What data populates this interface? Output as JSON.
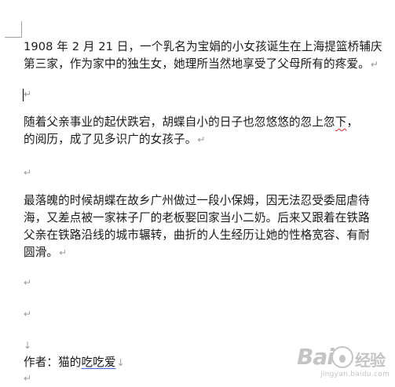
{
  "document": {
    "lines": [
      {
        "text": "1908 年 2 月 21 日，一个乳名为宝娟的小女孩诞生在上海提篮桥辅庆"
      },
      {
        "text": "第三家，作为家中的独生女，她理所当然地享受了父母所有的疼爱。"
      },
      {
        "text": ""
      },
      {
        "text": ""
      },
      {
        "text_before": "随着父亲事业的起伏跌宕，胡蝶自小的日子也忽悠悠的忽上忽",
        "squiggle": "下",
        "text_after": "，"
      },
      {
        "text": "的阅历，成了见多识广的女孩子。"
      },
      {
        "text": ""
      },
      {
        "text": ""
      },
      {
        "text": "最落魄的时候胡蝶在故乡广州做过一段小保姆，因无法忍受委屈虐待"
      },
      {
        "text": "海，又差点被一家袜子厂的老板娶回家当小二奶。后来又跟着在铁路"
      },
      {
        "text": "父亲在铁路沿线的城市辗转，曲折的人生经历让她的性格宽容、有耐"
      },
      {
        "text": "圆滑。"
      },
      {
        "text": ""
      },
      {
        "text": ""
      },
      {
        "text": ""
      },
      {
        "text": ""
      },
      {
        "author_label": "作者：猫的",
        "author_name": "吃吃爱"
      },
      {
        "text": ""
      }
    ],
    "paragraph_mark": "↵",
    "line_break_mark": "↓"
  },
  "watermark": {
    "logo": "Bai",
    "logo_suffix": "经验",
    "sub": "jingyan.baidu.com"
  }
}
